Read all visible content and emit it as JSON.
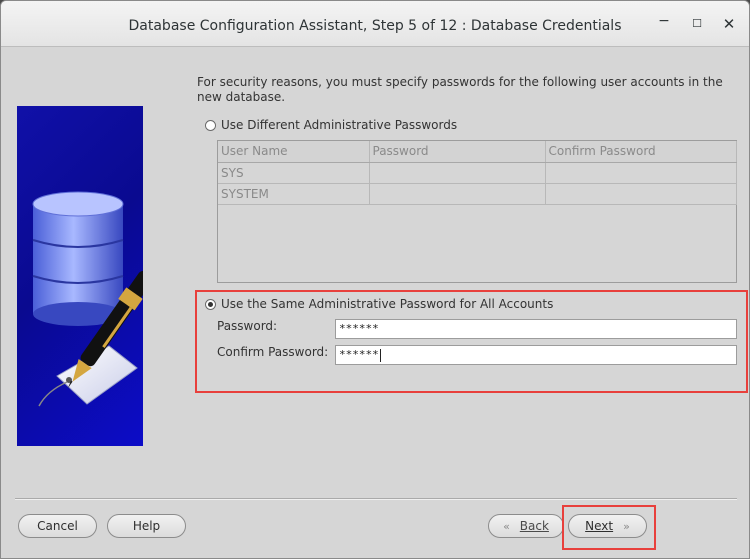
{
  "window": {
    "title": "Database Configuration Assistant, Step 5 of 12 : Database Credentials",
    "controls": {
      "minimize": "−",
      "maximize": "☐",
      "close": "✕"
    }
  },
  "content": {
    "intro": "For security reasons, you must specify passwords for the following user accounts in the new database.",
    "option_different": "Use Different Administrative Passwords",
    "option_same": "Use the Same Administrative Password for All Accounts",
    "table": {
      "columns": [
        "User Name",
        "Password",
        "Confirm Password"
      ],
      "rows": [
        [
          "SYS",
          "",
          ""
        ],
        [
          "SYSTEM",
          "",
          ""
        ]
      ]
    },
    "password_label": "Password:",
    "password_value": "******",
    "confirm_label": "Confirm Password:",
    "confirm_value": "******"
  },
  "buttons": {
    "cancel": "Cancel",
    "help": "Help",
    "back": "Back",
    "next": "Next",
    "back_arrow": "«",
    "next_arrow": "»"
  },
  "colors": {
    "highlight": "#e8403c",
    "side_image_blue": "#1010a8"
  }
}
